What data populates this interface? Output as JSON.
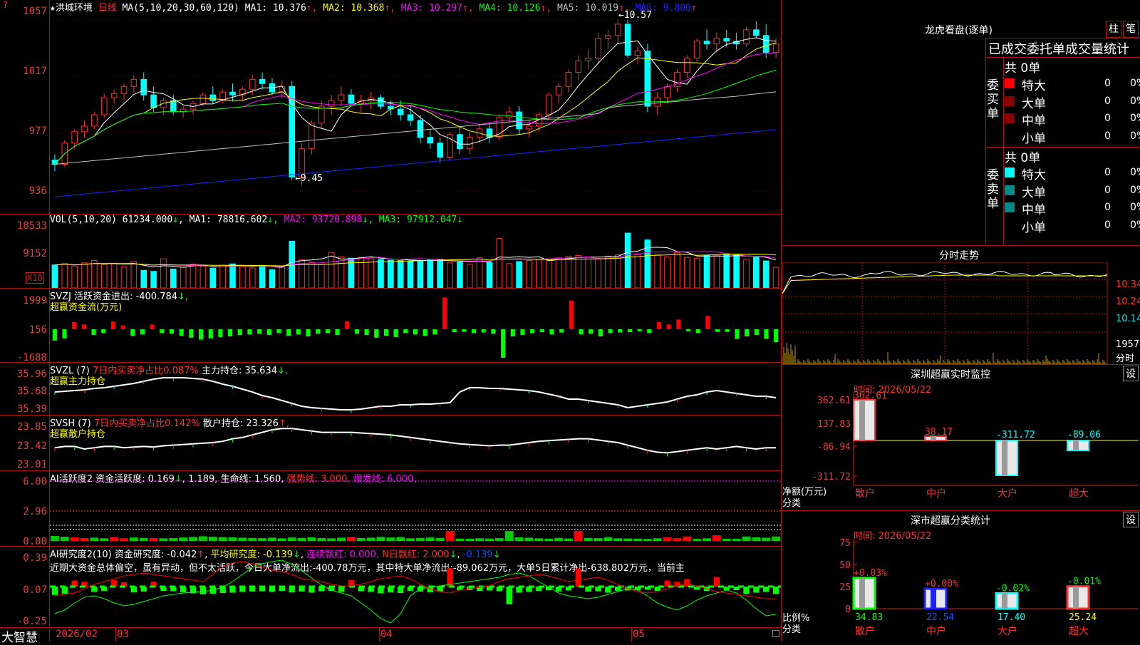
{
  "stock": {
    "star": "★",
    "name": "洪城环境",
    "period": "日线",
    "ma_label": "MA(5,10,20,30,60,120)",
    "ma": [
      {
        "label": "MA1:",
        "value": "10.376",
        "color": "#ffffff"
      },
      {
        "label": "MA2:",
        "value": "10.368",
        "color": "#ffff00"
      },
      {
        "label": "MA3:",
        "value": "10.297",
        "color": "#ff00ff"
      },
      {
        "label": "MA4:",
        "value": "10.126",
        "color": "#00ff00"
      },
      {
        "label": "MA5:",
        "value": "10.019",
        "color": "#c0c0c0"
      },
      {
        "label": "MA6:",
        "value": "9.800",
        "color": "#2020ff"
      }
    ],
    "up_arrow": "↑",
    "high_marker": "10.57",
    "low_marker": "9.45"
  },
  "price_axis": {
    "labels": [
      "1057",
      "1017",
      "977",
      "936"
    ],
    "min": 9.2,
    "max": 10.62
  },
  "vol": {
    "title": "VOL(5,10,20)",
    "value": "61234.000",
    "ma": [
      {
        "label": "MA1:",
        "value": "78816.602",
        "color": "#ffffff"
      },
      {
        "label": "MA2:",
        "value": "93720.898",
        "color": "#ff00ff"
      },
      {
        "label": "MA3:",
        "value": "97912.047",
        "color": "#00ff00"
      }
    ],
    "down_arrow": "↓",
    "axis": [
      "18533",
      "9152"
    ],
    "unit": "X10"
  },
  "svzj": {
    "title": "SVZJ",
    "label": "活跃资金进出:",
    "value": "-400.784",
    "sub": "超赢资金流(万元)",
    "axis": [
      "1999",
      "156",
      "-1688"
    ]
  },
  "svzl": {
    "title": "SVZL (7)",
    "ratio": "7日内买卖净占比0.087%",
    "label": "主力持仓:",
    "value": "35.634",
    "sub": "超赢主力持仓",
    "axis": [
      "35.96",
      "35.68",
      "35.39"
    ]
  },
  "svsh": {
    "title": "SVSH (7)",
    "ratio": "7日内买卖净占比0.142%",
    "label": "散户持仓:",
    "value": "23.326",
    "sub": "超赢散户持仓",
    "axis": [
      "23.85",
      "23.42",
      "23.01"
    ]
  },
  "ai_active": {
    "title": "AI活跃度2",
    "label": "资金活跃度:",
    "v1": "0.169",
    "v2": "1.189,",
    "life_label": "生命线:",
    "life_value": "1.560,",
    "strong": "强势线: 3.000,",
    "burst": "爆发线: 6.000,",
    "axis": [
      "6.00",
      "2.96",
      "0.00"
    ]
  },
  "ai_research": {
    "title": "AI研究度2(10)",
    "label": "资金研究度:",
    "value": "-0.042",
    "avg_label": "平均研究度:",
    "avg_value": "-0.139",
    "cont": "连续飘红: 0.000,",
    "nday": "N日飘红: 2.000",
    "extra": "-0.139",
    "comment": "近期大资金总体偏空，虽有异动，但不太活跃，今日大单净流出:-400.78万元，其中特大单净流出:-89.062万元，大单5日累计净出-638.802万元，当前主",
    "axis": [
      "0.39",
      "0.07",
      "-0.25"
    ]
  },
  "bottom_axis": {
    "brand": "大智慧",
    "dates": [
      "2026/02",
      "03",
      "04",
      "05"
    ]
  },
  "lhb": {
    "title": "龙虎看盘(逐单)",
    "btn1": "柱",
    "btn2": "笔",
    "header": "已成交委托单成交量统计",
    "buy_label": "委买单",
    "sell_label": "委卖单",
    "buy_total": "共 0单",
    "sell_total": "共 0单",
    "buy_rows": [
      {
        "name": "特大",
        "count": "0",
        "pct": "0%",
        "color": "#ff0000"
      },
      {
        "name": "大单",
        "count": "0",
        "pct": "0%",
        "color": "#8b0000"
      },
      {
        "name": "中单",
        "count": "0",
        "pct": "0%",
        "color": "#8b0000"
      },
      {
        "name": "小单",
        "count": "0",
        "pct": "0%",
        "color": ""
      }
    ],
    "sell_rows": [
      {
        "name": "特大",
        "count": "0",
        "pct": "0%",
        "color": "#00ffff"
      },
      {
        "name": "大单",
        "count": "0",
        "pct": "0%",
        "color": "#008b8b"
      },
      {
        "name": "中单",
        "count": "0",
        "pct": "0%",
        "color": "#008b8b"
      },
      {
        "name": "小单",
        "count": "0",
        "pct": "0%",
        "color": ""
      }
    ]
  },
  "intraday": {
    "title": "分时走势",
    "price_labels": [
      "10.34",
      "10.24",
      "10.14"
    ],
    "vol_label": "1957",
    "vol_unit": "分时"
  },
  "monitor": {
    "title": "深圳超赢实时监控",
    "btn": "设",
    "time": "时间: 2026/05/22",
    "axis": [
      "362.61",
      "137.83",
      "-86.94",
      "-311.72"
    ],
    "unit_label": "净额(万元)",
    "cat_label": "分类",
    "categories": [
      "散户",
      "中户",
      "大户",
      "超大"
    ],
    "values": [
      362.61,
      38.17,
      -311.72,
      -89.06
    ],
    "value_labels": [
      "362.61",
      "38.17",
      "-311.72",
      "-89.06"
    ]
  },
  "classify": {
    "title": "深市超赢分类统计",
    "btn": "设",
    "time": "时间: 2026/05/22",
    "axis": [
      "75",
      "50",
      "25",
      "0"
    ],
    "ratio_label": "比例%",
    "cat_label": "分类",
    "categories": [
      "散户",
      "中户",
      "大户",
      "超大"
    ],
    "values": [
      34.83,
      22.54,
      17.4,
      25.24
    ],
    "value_labels": [
      "34.83",
      "22.54",
      "17.40",
      "25.24"
    ],
    "changes": [
      "+0.03%",
      "+0.00%",
      "-0.02%",
      "-0.01%"
    ]
  },
  "chart_data": {
    "type": "candlestick",
    "candles": [
      [
        9.58,
        9.62,
        9.5,
        9.55
      ],
      [
        9.55,
        9.72,
        9.53,
        9.7
      ],
      [
        9.7,
        9.8,
        9.66,
        9.78
      ],
      [
        9.78,
        9.86,
        9.74,
        9.82
      ],
      [
        9.82,
        9.92,
        9.8,
        9.9
      ],
      [
        9.9,
        10.05,
        9.88,
        10.02
      ],
      [
        10.02,
        10.08,
        9.98,
        10.05
      ],
      [
        10.05,
        10.12,
        10.0,
        10.1
      ],
      [
        10.1,
        10.18,
        10.06,
        10.15
      ],
      [
        10.15,
        10.2,
        10.0,
        10.04
      ],
      [
        10.04,
        10.1,
        9.92,
        9.95
      ],
      [
        9.95,
        10.02,
        9.9,
        10.0
      ],
      [
        10.0,
        10.04,
        9.9,
        9.92
      ],
      [
        9.92,
        9.96,
        9.88,
        9.94
      ],
      [
        9.94,
        10.0,
        9.9,
        9.98
      ],
      [
        9.98,
        10.06,
        9.96,
        10.04
      ],
      [
        10.04,
        10.1,
        9.98,
        10.0
      ],
      [
        10.0,
        10.08,
        9.98,
        10.06
      ],
      [
        10.06,
        10.12,
        10.0,
        10.04
      ],
      [
        10.04,
        10.1,
        10.0,
        10.08
      ],
      [
        10.08,
        10.18,
        10.04,
        10.15
      ],
      [
        10.15,
        10.2,
        10.08,
        10.12
      ],
      [
        10.12,
        10.16,
        10.04,
        10.06
      ],
      [
        10.06,
        10.14,
        10.02,
        10.1
      ],
      [
        10.1,
        10.14,
        9.44,
        9.46
      ],
      [
        9.46,
        9.7,
        9.4,
        9.66
      ],
      [
        9.66,
        9.86,
        9.62,
        9.84
      ],
      [
        9.84,
        10.0,
        9.8,
        9.96
      ],
      [
        9.96,
        10.04,
        9.9,
        10.0
      ],
      [
        10.0,
        10.1,
        9.96,
        10.04
      ],
      [
        10.04,
        10.08,
        9.96,
        9.98
      ],
      [
        9.98,
        10.04,
        9.92,
        10.0
      ],
      [
        10.0,
        10.06,
        9.94,
        10.02
      ],
      [
        10.02,
        10.04,
        9.94,
        9.96
      ],
      [
        9.96,
        10.0,
        9.9,
        9.94
      ],
      [
        9.94,
        10.0,
        9.86,
        9.9
      ],
      [
        9.9,
        9.96,
        9.82,
        9.86
      ],
      [
        9.86,
        9.9,
        9.7,
        9.74
      ],
      [
        9.74,
        9.8,
        9.66,
        9.7
      ],
      [
        9.7,
        9.74,
        9.56,
        9.6
      ],
      [
        9.6,
        9.78,
        9.58,
        9.76
      ],
      [
        9.76,
        9.82,
        9.62,
        9.66
      ],
      [
        9.66,
        9.78,
        9.62,
        9.74
      ],
      [
        9.74,
        9.84,
        9.7,
        9.8
      ],
      [
        9.8,
        9.84,
        9.7,
        9.74
      ],
      [
        9.74,
        9.9,
        9.72,
        9.88
      ],
      [
        9.88,
        9.96,
        9.84,
        9.92
      ],
      [
        9.92,
        9.96,
        9.76,
        9.8
      ],
      [
        9.8,
        9.86,
        9.74,
        9.82
      ],
      [
        9.82,
        9.92,
        9.78,
        9.9
      ],
      [
        9.9,
        10.06,
        9.86,
        10.04
      ],
      [
        10.04,
        10.12,
        9.98,
        10.1
      ],
      [
        10.1,
        10.22,
        10.06,
        10.2
      ],
      [
        10.2,
        10.32,
        10.14,
        10.28
      ],
      [
        10.28,
        10.36,
        10.22,
        10.3
      ],
      [
        10.3,
        10.48,
        10.26,
        10.44
      ],
      [
        10.44,
        10.5,
        10.36,
        10.46
      ],
      [
        10.46,
        10.57,
        10.4,
        10.54
      ],
      [
        10.54,
        10.57,
        10.3,
        10.32
      ],
      [
        10.32,
        10.38,
        10.26,
        10.35
      ],
      [
        10.35,
        10.4,
        9.92,
        9.96
      ],
      [
        9.96,
        10.06,
        9.9,
        10.02
      ],
      [
        10.02,
        10.12,
        9.98,
        10.1
      ],
      [
        10.1,
        10.22,
        10.06,
        10.2
      ],
      [
        10.2,
        10.32,
        10.16,
        10.3
      ],
      [
        10.3,
        10.44,
        10.28,
        10.42
      ],
      [
        10.42,
        10.5,
        10.36,
        10.4
      ],
      [
        10.4,
        10.48,
        10.34,
        10.44
      ],
      [
        10.44,
        10.5,
        10.38,
        10.42
      ],
      [
        10.42,
        10.48,
        10.36,
        10.4
      ],
      [
        10.4,
        10.52,
        10.38,
        10.5
      ],
      [
        10.5,
        10.56,
        10.44,
        10.46
      ],
      [
        10.46,
        10.54,
        10.3,
        10.34
      ],
      [
        10.34,
        10.44,
        10.3,
        10.4
      ]
    ],
    "volume": [
      6800,
      7200,
      6500,
      7400,
      8100,
      6900,
      7300,
      6200,
      7800,
      5200,
      4900,
      8600,
      5600,
      6100,
      7000,
      6400,
      5800,
      6700,
      7100,
      6300,
      5900,
      6600,
      5400,
      6200,
      13800,
      8400,
      7600,
      6900,
      10500,
      9200,
      8800,
      9000,
      8600,
      8400,
      8200,
      8100,
      7900,
      8000,
      8300,
      8500,
      7400,
      7700,
      7000,
      8900,
      7500,
      14600,
      7200,
      7800,
      8100,
      8400,
      8600,
      8900,
      9300,
      9600,
      9100,
      8700,
      9400,
      9800,
      16200,
      10100,
      14200,
      9800,
      9200,
      10400,
      9000,
      8800,
      9600,
      9500,
      10100,
      9700,
      8400,
      9100,
      8000,
      6100
    ],
    "flow": [
      -350,
      -280,
      220,
      150,
      -180,
      -120,
      240,
      120,
      -200,
      -160,
      150,
      -120,
      -140,
      -200,
      -260,
      -320,
      -280,
      -240,
      -220,
      -180,
      -160,
      -140,
      -180,
      -120,
      -200,
      -160,
      -220,
      -140,
      -120,
      -180,
      250,
      -140,
      -180,
      -260,
      -200,
      -240,
      -120,
      -160,
      -200,
      -160,
      980,
      -90,
      -80,
      -120,
      -100,
      -140,
      -880,
      -220,
      -180,
      -120,
      -90,
      -160,
      -100,
      880,
      -160,
      -140,
      -220,
      -120,
      -100,
      -90,
      -60,
      -120,
      220,
      150,
      300,
      -60,
      -120,
      420,
      -80,
      -80,
      -300,
      -220,
      -180,
      -300,
      -400
    ],
    "ma_colors": [
      "#ffffff",
      "#ffff00",
      "#ff00ff",
      "#00ff00",
      "#c0c0c0",
      "#2020ff"
    ]
  }
}
